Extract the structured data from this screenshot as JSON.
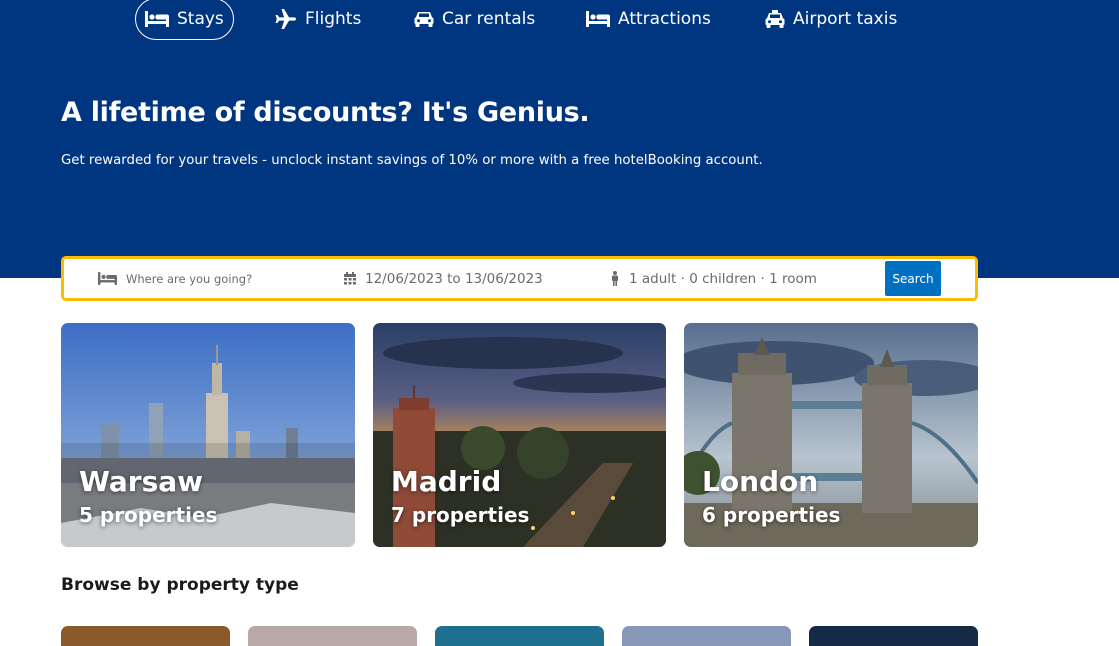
{
  "nav": {
    "items": [
      {
        "label": "Stays",
        "icon": "bed-icon",
        "active": true
      },
      {
        "label": "Flights",
        "icon": "plane-icon"
      },
      {
        "label": "Car rentals",
        "icon": "car-icon"
      },
      {
        "label": "Attractions",
        "icon": "bed-icon"
      },
      {
        "label": "Airport taxis",
        "icon": "taxi-icon"
      }
    ]
  },
  "hero": {
    "title": "A lifetime of discounts? It's Genius.",
    "subtitle": "Get rewarded for your travels - unclock instant savings of 10% or more with a free hotelBooking account."
  },
  "search": {
    "destination_placeholder": "Where are you going?",
    "dates": "12/06/2023 to 13/06/2023",
    "guests": "1 adult · 0 children · 1 room",
    "button_label": "Search"
  },
  "cities": [
    {
      "name": "Warsaw",
      "properties": "5 properties"
    },
    {
      "name": "Madrid",
      "properties": "7 properties"
    },
    {
      "name": "London",
      "properties": "6 properties"
    }
  ],
  "property_types": {
    "title": "Browse by property type"
  },
  "colors": {
    "brand_blue": "#003580",
    "search_border": "#febb02",
    "button_blue": "#0071c2"
  }
}
